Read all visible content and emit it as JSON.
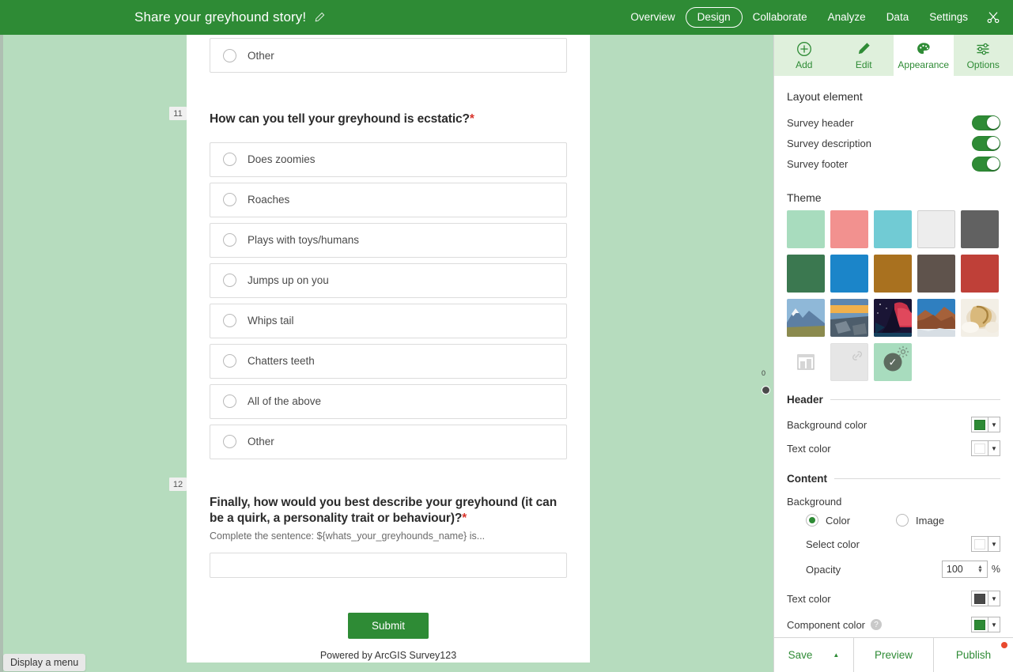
{
  "appbar": {
    "title": "Share your greyhound story!",
    "edit_icon": "pencil-icon",
    "nav": [
      {
        "label": "Overview",
        "active": false
      },
      {
        "label": "Design",
        "active": true
      },
      {
        "label": "Collaborate",
        "active": false
      },
      {
        "label": "Analyze",
        "active": false
      },
      {
        "label": "Data",
        "active": false
      },
      {
        "label": "Settings",
        "active": false
      }
    ],
    "tool_icon": "scissors-icon",
    "background_color": "#2e8b35",
    "text_color": "#ffffff"
  },
  "preview": {
    "background_color": "#b6dcbe",
    "card_background": "#ffffff",
    "partial_question": {
      "choices": [
        {
          "label": "Other"
        }
      ]
    },
    "questions": [
      {
        "number": "11",
        "title": "How can you tell your greyhound is ecstatic?",
        "required_mark": "*",
        "choices": [
          {
            "label": "Does zoomies"
          },
          {
            "label": "Roaches"
          },
          {
            "label": "Plays with toys/humans"
          },
          {
            "label": "Jumps up on you"
          },
          {
            "label": "Whips tail"
          },
          {
            "label": "Chatters teeth"
          },
          {
            "label": "All of the above"
          },
          {
            "label": "Other"
          }
        ]
      },
      {
        "number": "12",
        "title": "Finally, how would you best describe your greyhound (it can be a quirk, a personality trait or behaviour)?",
        "required_mark": "*",
        "hint": "Complete the sentence: ${whats_your_greyhounds_name} is...",
        "input_value": "",
        "input_placeholder": ""
      }
    ],
    "submit_label": "Submit",
    "footer_text": "Powered by ArcGIS Survey123",
    "slider_value": "0"
  },
  "status_tip": {
    "label": "Display a menu"
  },
  "panel": {
    "tabs": [
      {
        "label": "Add",
        "icon": "plus-circle-icon",
        "active": false
      },
      {
        "label": "Edit",
        "icon": "pencil-icon",
        "active": false
      },
      {
        "label": "Appearance",
        "icon": "palette-icon",
        "active": true
      },
      {
        "label": "Options",
        "icon": "sliders-icon",
        "active": false
      }
    ],
    "layout_element": {
      "title": "Layout element",
      "rows": [
        {
          "label": "Survey header",
          "on": true
        },
        {
          "label": "Survey description",
          "on": true
        },
        {
          "label": "Survey footer",
          "on": true
        }
      ]
    },
    "theme": {
      "title": "Theme",
      "swatches": [
        {
          "name": "mint",
          "color": "#a8dcbe",
          "kind": "color"
        },
        {
          "name": "salmon",
          "color": "#f2918f",
          "kind": "color"
        },
        {
          "name": "aqua",
          "color": "#71cbd4",
          "kind": "color"
        },
        {
          "name": "white",
          "color": "#ededed",
          "kind": "color",
          "bordered": true
        },
        {
          "name": "dark-gray",
          "color": "#616161",
          "kind": "color"
        },
        {
          "name": "forest-green",
          "color": "#3b7850",
          "kind": "color"
        },
        {
          "name": "blue",
          "color": "#1b85c9",
          "kind": "color"
        },
        {
          "name": "ochre",
          "color": "#a9711f",
          "kind": "color"
        },
        {
          "name": "taupe",
          "color": "#5f534c",
          "kind": "color"
        },
        {
          "name": "brick-red",
          "color": "#bf4038",
          "kind": "color"
        },
        {
          "name": "mountain-photo",
          "kind": "photo"
        },
        {
          "name": "shoreline-photo",
          "kind": "photo"
        },
        {
          "name": "aurora-photo",
          "kind": "photo"
        },
        {
          "name": "canyon-photo",
          "kind": "photo"
        },
        {
          "name": "shell-photo",
          "kind": "photo"
        },
        {
          "name": "custom-image",
          "kind": "image-placeholder"
        },
        {
          "name": "custom-link",
          "kind": "link-placeholder"
        },
        {
          "name": "current-theme",
          "color": "#a8dcbe",
          "kind": "selected",
          "check": "✓"
        }
      ]
    },
    "header_section": {
      "title": "Header",
      "rows": [
        {
          "label": "Background color",
          "swatch": "#2e8b35",
          "name": "header-background-color"
        },
        {
          "label": "Text color",
          "swatch": "#ffffff",
          "name": "header-text-color"
        }
      ]
    },
    "content_section": {
      "title": "Content",
      "background_label": "Background",
      "background_options": [
        {
          "label": "Color",
          "selected": true
        },
        {
          "label": "Image",
          "selected": false
        }
      ],
      "select_color_label": "Select color",
      "select_color_swatch": "#ffffff",
      "opacity_label": "Opacity",
      "opacity_value": "100",
      "opacity_unit": "%",
      "text_color_label": "Text color",
      "text_color_swatch": "#4a4a4a",
      "component_color_label": "Component color",
      "component_color_swatch": "#2e8b35",
      "component_help_icon": "help-icon"
    },
    "actions": [
      {
        "label": "Save",
        "caret": "▲",
        "name": "save-button"
      },
      {
        "label": "Preview",
        "name": "preview-button"
      },
      {
        "label": "Publish",
        "name": "publish-button",
        "badge": true
      }
    ]
  }
}
